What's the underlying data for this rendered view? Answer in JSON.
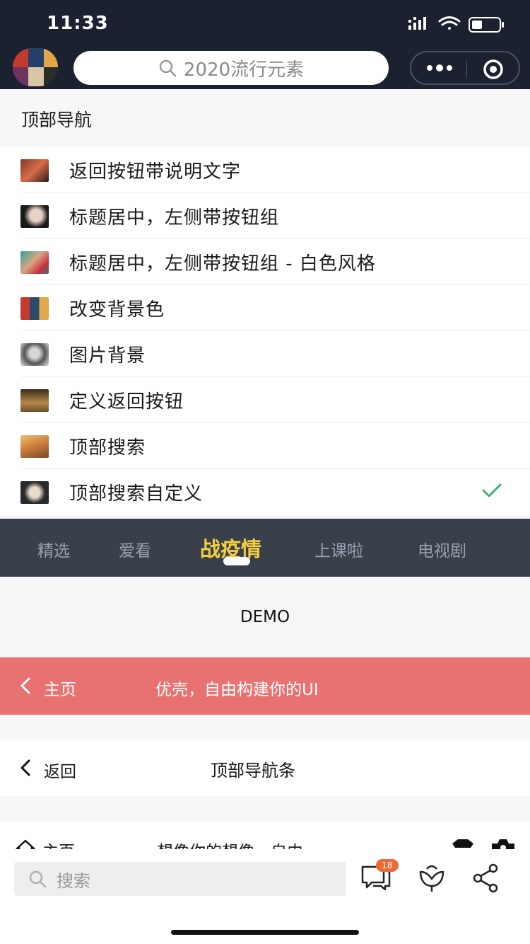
{
  "status_bar": {
    "time": "11:33"
  },
  "top_search": {
    "placeholder": "2020流行元素"
  },
  "section": {
    "title": "顶部导航"
  },
  "list": {
    "items": [
      {
        "label": "返回按钮带说明文字",
        "checked": false
      },
      {
        "label": "标题居中，左侧带按钮组",
        "checked": false
      },
      {
        "label": "标题居中，左侧带按钮组 - 白色风格",
        "checked": false
      },
      {
        "label": "改变背景色",
        "checked": false
      },
      {
        "label": "图片背景",
        "checked": false
      },
      {
        "label": "定义返回按钮",
        "checked": false
      },
      {
        "label": "顶部搜索",
        "checked": false
      },
      {
        "label": "顶部搜索自定义",
        "checked": true
      }
    ]
  },
  "tabs": {
    "items": [
      "精选",
      "爱看",
      "战疫情",
      "上课啦",
      "电视剧"
    ],
    "active_index": 2
  },
  "demo": {
    "text": "DEMO"
  },
  "red_nav": {
    "back_label": "主页",
    "title": "优壳，自由构建你的UI",
    "background": "#e87272"
  },
  "white_nav": {
    "back_label": "返回",
    "title": "顶部导航条"
  },
  "partial_nav": {
    "home_label": "主页",
    "title": "想像你的想像，自由"
  },
  "bottom_bar": {
    "search_placeholder": "搜索",
    "message_badge": "18"
  },
  "colors": {
    "header_bg": "#1c2130",
    "tab_bg": "#3a3f4c",
    "tab_active": "#f5cf40",
    "check_green": "#3cb371",
    "badge": "#ee6a34"
  }
}
